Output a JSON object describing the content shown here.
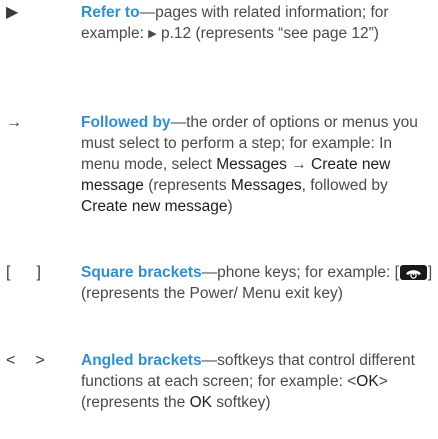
{
  "entries": [
    {
      "symbol": "▶",
      "term": "Refer to",
      "text_before": "—pages with related information; for example: ",
      "inline_symbol": "▶",
      "text_after": " p.12 (represents “see page 12”)"
    },
    {
      "symbol": "→",
      "term": "Followed by",
      "text_before": "—the order of options or menus you must select to perform a step; for example: In menu mode, select ",
      "ui_1": "Messages",
      "arrow": " → ",
      "ui_2": "Create new message",
      "text_mid": " (represents ",
      "ui_3": "Messages",
      "text_mid2": ", followed by ",
      "ui_4": "Create new message",
      "text_after": ")"
    },
    {
      "symbol_left": "[",
      "symbol_right": "]",
      "term": "Square brackets",
      "text_before": "—phone keys; for example: [",
      "key_icon": "power-end-key-icon",
      "text_after": "] (represents the Power/ Menu exit key)"
    },
    {
      "symbol_left": "<",
      "symbol_right": ">",
      "term": "Angled brackets",
      "text_before": "—softkeys that control different functions at each screen; for example: <",
      "ui_1": "OK",
      "text_mid": "> (represents the ",
      "ui_2": "OK",
      "text_after": " softkey)"
    }
  ],
  "colors": {
    "term": "#2f8fd6",
    "body": "#4a4a4a",
    "ui": "#1e1e1e"
  }
}
